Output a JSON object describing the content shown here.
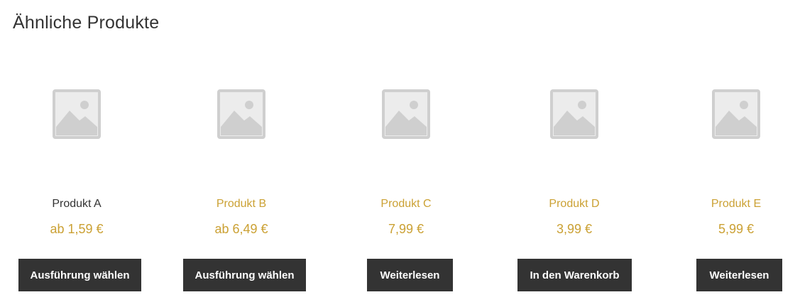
{
  "section": {
    "title": "Ähnliche Produkte"
  },
  "products": [
    {
      "name": "Produkt A",
      "price": "ab 1,59 €",
      "button": "Ausführung wählen"
    },
    {
      "name": "Produkt B",
      "price": "ab 6,49 €",
      "button": "Ausführung wählen"
    },
    {
      "name": "Produkt C",
      "price": "7,99 €",
      "button": "Weiterlesen"
    },
    {
      "name": "Produkt D",
      "price": "3,99 €",
      "button": "In den Warenkorb"
    },
    {
      "name": "Produkt E",
      "price": "5,99 €",
      "button": "Weiterlesen"
    }
  ],
  "colors": {
    "accent": "#cba134",
    "text": "#333333",
    "button_bg": "#333333",
    "button_text": "#ffffff",
    "placeholder": "#d4d4d4"
  },
  "icons": {
    "placeholder": "image-placeholder-icon"
  }
}
